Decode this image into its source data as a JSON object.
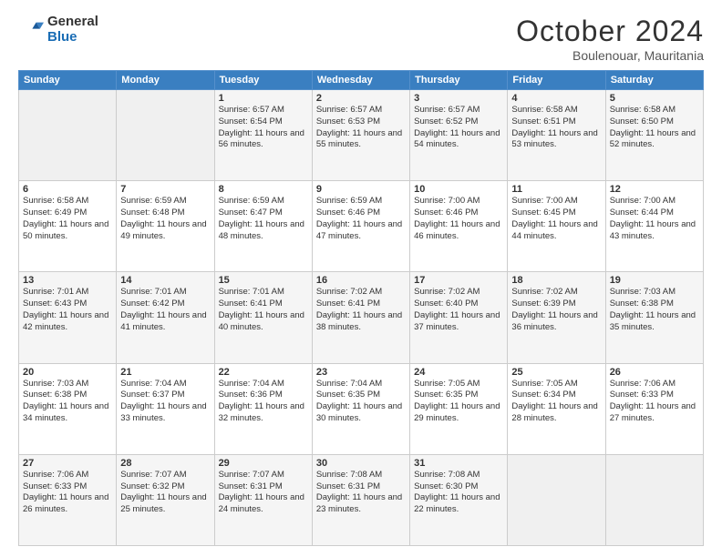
{
  "logo": {
    "general": "General",
    "blue": "Blue"
  },
  "header": {
    "month": "October 2024",
    "location": "Boulenouar, Mauritania"
  },
  "weekdays": [
    "Sunday",
    "Monday",
    "Tuesday",
    "Wednesday",
    "Thursday",
    "Friday",
    "Saturday"
  ],
  "weeks": [
    [
      {
        "day": "",
        "detail": ""
      },
      {
        "day": "",
        "detail": ""
      },
      {
        "day": "1",
        "detail": "Sunrise: 6:57 AM\nSunset: 6:54 PM\nDaylight: 11 hours and 56 minutes."
      },
      {
        "day": "2",
        "detail": "Sunrise: 6:57 AM\nSunset: 6:53 PM\nDaylight: 11 hours and 55 minutes."
      },
      {
        "day": "3",
        "detail": "Sunrise: 6:57 AM\nSunset: 6:52 PM\nDaylight: 11 hours and 54 minutes."
      },
      {
        "day": "4",
        "detail": "Sunrise: 6:58 AM\nSunset: 6:51 PM\nDaylight: 11 hours and 53 minutes."
      },
      {
        "day": "5",
        "detail": "Sunrise: 6:58 AM\nSunset: 6:50 PM\nDaylight: 11 hours and 52 minutes."
      }
    ],
    [
      {
        "day": "6",
        "detail": "Sunrise: 6:58 AM\nSunset: 6:49 PM\nDaylight: 11 hours and 50 minutes."
      },
      {
        "day": "7",
        "detail": "Sunrise: 6:59 AM\nSunset: 6:48 PM\nDaylight: 11 hours and 49 minutes."
      },
      {
        "day": "8",
        "detail": "Sunrise: 6:59 AM\nSunset: 6:47 PM\nDaylight: 11 hours and 48 minutes."
      },
      {
        "day": "9",
        "detail": "Sunrise: 6:59 AM\nSunset: 6:46 PM\nDaylight: 11 hours and 47 minutes."
      },
      {
        "day": "10",
        "detail": "Sunrise: 7:00 AM\nSunset: 6:46 PM\nDaylight: 11 hours and 46 minutes."
      },
      {
        "day": "11",
        "detail": "Sunrise: 7:00 AM\nSunset: 6:45 PM\nDaylight: 11 hours and 44 minutes."
      },
      {
        "day": "12",
        "detail": "Sunrise: 7:00 AM\nSunset: 6:44 PM\nDaylight: 11 hours and 43 minutes."
      }
    ],
    [
      {
        "day": "13",
        "detail": "Sunrise: 7:01 AM\nSunset: 6:43 PM\nDaylight: 11 hours and 42 minutes."
      },
      {
        "day": "14",
        "detail": "Sunrise: 7:01 AM\nSunset: 6:42 PM\nDaylight: 11 hours and 41 minutes."
      },
      {
        "day": "15",
        "detail": "Sunrise: 7:01 AM\nSunset: 6:41 PM\nDaylight: 11 hours and 40 minutes."
      },
      {
        "day": "16",
        "detail": "Sunrise: 7:02 AM\nSunset: 6:41 PM\nDaylight: 11 hours and 38 minutes."
      },
      {
        "day": "17",
        "detail": "Sunrise: 7:02 AM\nSunset: 6:40 PM\nDaylight: 11 hours and 37 minutes."
      },
      {
        "day": "18",
        "detail": "Sunrise: 7:02 AM\nSunset: 6:39 PM\nDaylight: 11 hours and 36 minutes."
      },
      {
        "day": "19",
        "detail": "Sunrise: 7:03 AM\nSunset: 6:38 PM\nDaylight: 11 hours and 35 minutes."
      }
    ],
    [
      {
        "day": "20",
        "detail": "Sunrise: 7:03 AM\nSunset: 6:38 PM\nDaylight: 11 hours and 34 minutes."
      },
      {
        "day": "21",
        "detail": "Sunrise: 7:04 AM\nSunset: 6:37 PM\nDaylight: 11 hours and 33 minutes."
      },
      {
        "day": "22",
        "detail": "Sunrise: 7:04 AM\nSunset: 6:36 PM\nDaylight: 11 hours and 32 minutes."
      },
      {
        "day": "23",
        "detail": "Sunrise: 7:04 AM\nSunset: 6:35 PM\nDaylight: 11 hours and 30 minutes."
      },
      {
        "day": "24",
        "detail": "Sunrise: 7:05 AM\nSunset: 6:35 PM\nDaylight: 11 hours and 29 minutes."
      },
      {
        "day": "25",
        "detail": "Sunrise: 7:05 AM\nSunset: 6:34 PM\nDaylight: 11 hours and 28 minutes."
      },
      {
        "day": "26",
        "detail": "Sunrise: 7:06 AM\nSunset: 6:33 PM\nDaylight: 11 hours and 27 minutes."
      }
    ],
    [
      {
        "day": "27",
        "detail": "Sunrise: 7:06 AM\nSunset: 6:33 PM\nDaylight: 11 hours and 26 minutes."
      },
      {
        "day": "28",
        "detail": "Sunrise: 7:07 AM\nSunset: 6:32 PM\nDaylight: 11 hours and 25 minutes."
      },
      {
        "day": "29",
        "detail": "Sunrise: 7:07 AM\nSunset: 6:31 PM\nDaylight: 11 hours and 24 minutes."
      },
      {
        "day": "30",
        "detail": "Sunrise: 7:08 AM\nSunset: 6:31 PM\nDaylight: 11 hours and 23 minutes."
      },
      {
        "day": "31",
        "detail": "Sunrise: 7:08 AM\nSunset: 6:30 PM\nDaylight: 11 hours and 22 minutes."
      },
      {
        "day": "",
        "detail": ""
      },
      {
        "day": "",
        "detail": ""
      }
    ]
  ]
}
